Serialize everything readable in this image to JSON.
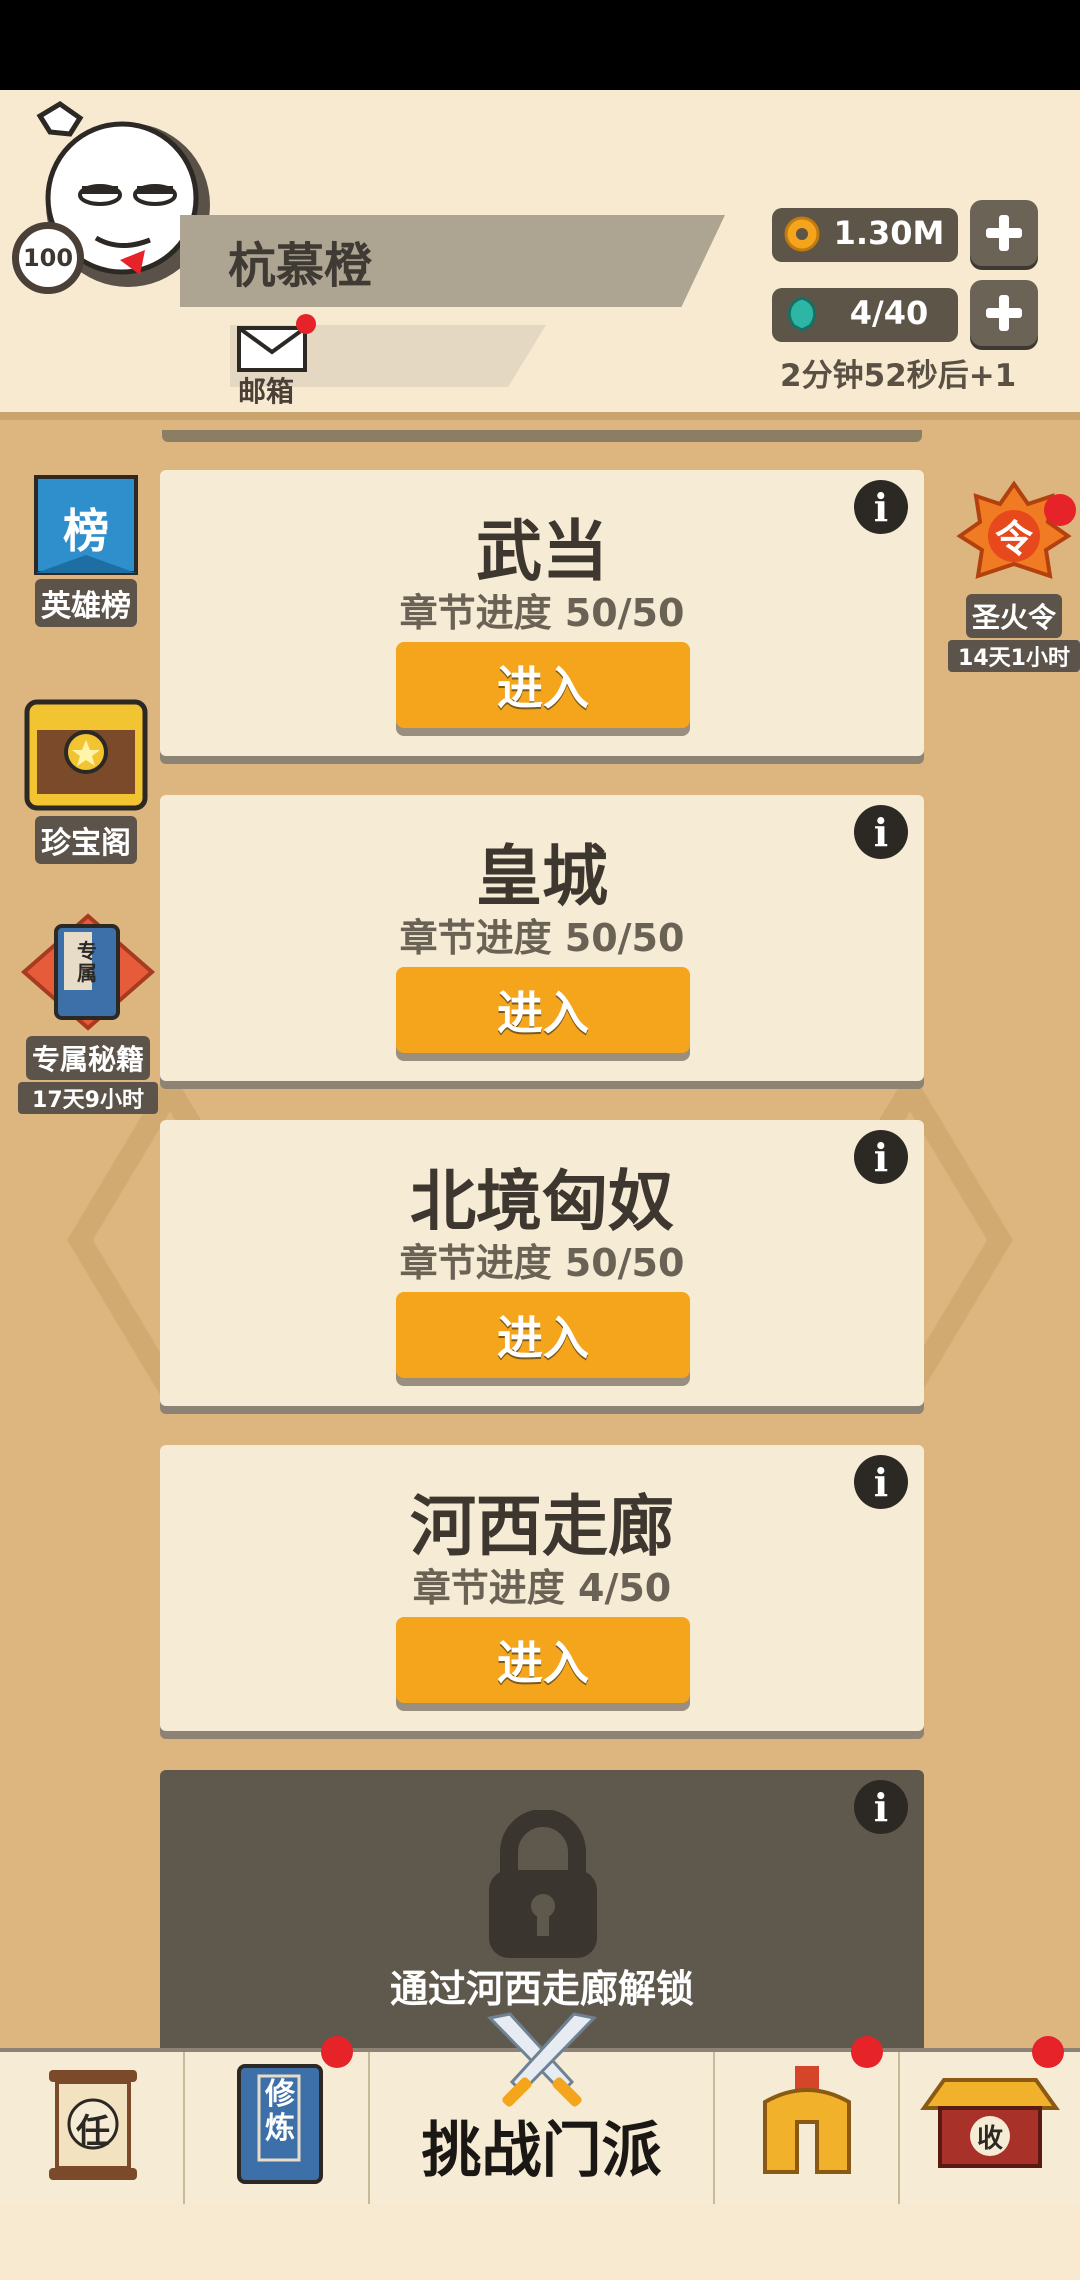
{
  "player": {
    "name": "杭慕橙",
    "level": "100"
  },
  "mail": {
    "label": "邮箱"
  },
  "resources": {
    "gold": "1.30M",
    "stamina": "4/40",
    "timer": "2分钟52秒后+1"
  },
  "left_menu": {
    "heroes": {
      "label": "英雄榜",
      "icon_text": "榜"
    },
    "treasure": {
      "label": "珍宝阁"
    },
    "secret": {
      "label": "专属秘籍",
      "time": "17天9小时",
      "icon_text": "专属"
    }
  },
  "right_menu": {
    "fire": {
      "label": "圣火令",
      "time": "14天1小时",
      "icon_text": "令"
    }
  },
  "sects": [
    {
      "title": "武当",
      "progress": "章节进度 50/50",
      "button": "进入"
    },
    {
      "title": "皇城",
      "progress": "章节进度 50/50",
      "button": "进入"
    },
    {
      "title": "北境匈奴",
      "progress": "章节进度 50/50",
      "button": "进入"
    },
    {
      "title": "河西走廊",
      "progress": "章节进度 4/50",
      "button": "进入"
    }
  ],
  "locked": {
    "text": "通过河西走廊解锁"
  },
  "info_icon": "i",
  "bottom_nav": {
    "task_icon_text": "任",
    "train_icon_text": "修炼",
    "challenge": "挑战门派",
    "collect_icon_text": "收"
  },
  "colors": {
    "accent": "#f5a51c",
    "background": "#dcb57f",
    "card": "#f6ebd4",
    "badge": "#e62329"
  }
}
